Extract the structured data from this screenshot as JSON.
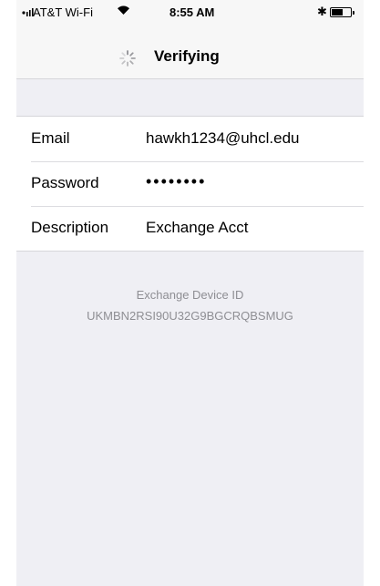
{
  "status_bar": {
    "carrier": "AT&T Wi-Fi",
    "time": "8:55 AM",
    "bluetooth": "✱",
    "battery_level": 0.6
  },
  "nav": {
    "title": "Verifying",
    "spinner_icon": "activity-spinner-icon"
  },
  "form": {
    "rows": [
      {
        "label": "Email",
        "value": "hawkh1234@uhcl.edu"
      },
      {
        "label": "Password",
        "value": "••••••••"
      },
      {
        "label": "Description",
        "value": "Exchange Acct"
      }
    ]
  },
  "footer": {
    "device_id_label": "Exchange Device ID",
    "device_id": "UKMBN2RSI90U32G9BGCRQBSMUG"
  },
  "colors": {
    "background": "#efeff4",
    "footer_text": "#8e8e93",
    "separator": "#d6d6da"
  }
}
